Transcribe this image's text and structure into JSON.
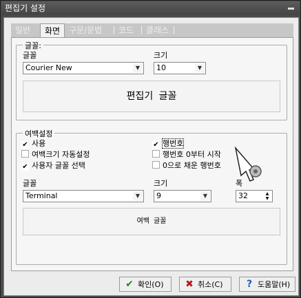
{
  "window": {
    "title": "편집기 설정"
  },
  "tabs": [
    {
      "label": "일반"
    },
    {
      "label": "화면"
    },
    {
      "label": "구문/문법"
    },
    {
      "label": "코드"
    },
    {
      "label": "클래스"
    }
  ],
  "font_group": {
    "legend": "글꼴:",
    "font_label": "글꼴",
    "font_value": "Courier New",
    "size_label": "크기",
    "size_value": "10",
    "preview_text": "편집기 글꼴"
  },
  "margin_group": {
    "legend": "여백설정",
    "checkboxes": [
      {
        "label": "사용",
        "checked": true
      },
      {
        "label": "여백크기 자동설정",
        "checked": false
      },
      {
        "label": "사용자 글꼴 선택",
        "checked": true
      },
      {
        "label": "행번호",
        "checked": true
      },
      {
        "label": "행번호 0부터 시작",
        "checked": false
      },
      {
        "label": "0으로 채운 행번호",
        "checked": false
      }
    ],
    "font_label": "글꼴",
    "font_value": "Terminal",
    "size_label": "크기",
    "size_value": "9",
    "width_label": "폭",
    "width_value": "32",
    "preview_text": "여백 글꼴"
  },
  "buttons": {
    "ok": "확인(O)",
    "cancel": "취소(C)",
    "help": "도움말(H)"
  }
}
